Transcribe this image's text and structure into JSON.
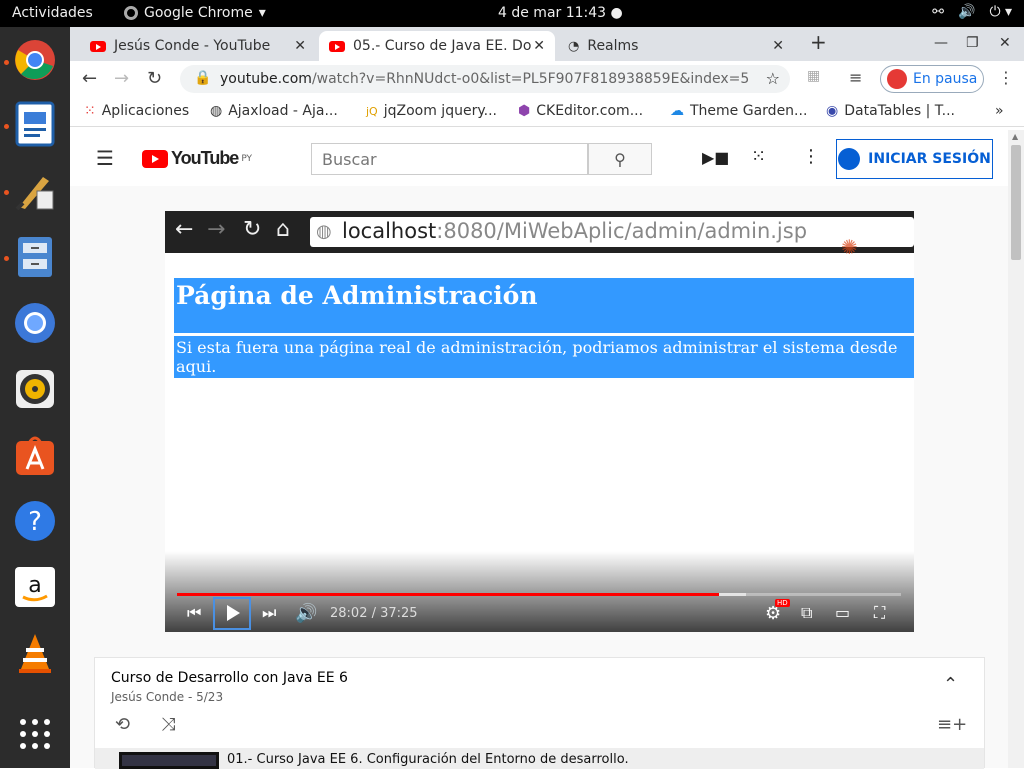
{
  "system": {
    "activities": "Actividades",
    "app_name": "Google Chrome",
    "clock": "4 de mar  11:43"
  },
  "tabs": [
    {
      "label": "Jesús Conde - YouTube"
    },
    {
      "label": "05.- Curso de Java EE. Do"
    },
    {
      "label": "Realms"
    }
  ],
  "address": {
    "host": "youtube.com",
    "path": "/watch?v=RhnNUdct-o0&list=PL5F907F818938859E&index=5"
  },
  "profile": {
    "label": "En pausa"
  },
  "bookmarks": [
    "Aplicaciones",
    "Ajaxload - Aja...",
    "jqZoom jquery...",
    "CKEditor.com...",
    "Theme Garden...",
    "DataTables | T..."
  ],
  "youtube": {
    "logo": "YouTube",
    "region": "PY",
    "search_placeholder": "Buscar",
    "signin": "INICIAR SESIÓN"
  },
  "video": {
    "url_host": "localhost",
    "url_path": ":8080/MiWebAplic/admin/admin.jsp",
    "page_title": "Página de Administración",
    "page_text": "Si esta fuera una página real de administración, podriamos administrar el sistema desde aqui.",
    "timecode": "28:02 / 37:25",
    "progress_fraction": 0.748,
    "hd_badge": "HD"
  },
  "playlist": {
    "title": "Curso de Desarrollo con Java EE 6",
    "subtitle": "Jesús Conde - 5/23",
    "first_item": "01.- Curso Java EE 6. Configuración del Entorno de desarrollo."
  }
}
